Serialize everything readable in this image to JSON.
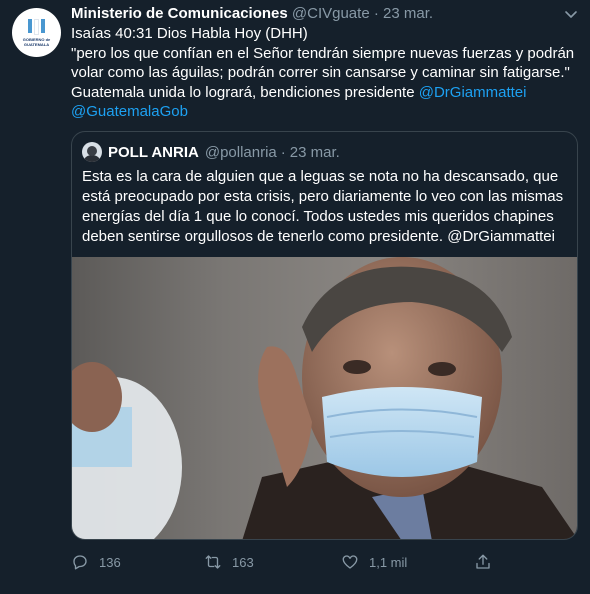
{
  "tweet": {
    "author_name": "Ministerio de Comunicaciones",
    "author_handle": "@CIVguate",
    "date": "23 mar.",
    "separator": "·",
    "avatar_logo_text": "GOBIERNO de GUATEMALA",
    "body": {
      "line1": "Isaías 40:31 Dios Habla Hoy (DHH)",
      "line2": "\"pero los que confían en el Señor tendrán siempre nuevas fuerzas y podrán",
      "line3": "volar como las águilas; podrán correr sin cansarse y caminar sin fatigarse.\"",
      "line4_text": "Guatemala unida lo logrará, bendiciones presidente ",
      "mention1": "@DrGiammattei",
      "mention2": "@GuatemalaGob"
    }
  },
  "quoted_tweet": {
    "author_name": "POLL ANRIA",
    "author_handle": "@pollanria",
    "separator": "·",
    "date": "23 mar.",
    "text": {
      "line1": "Esta es la cara de alguien que a leguas se nota no ha descansado, que",
      "line2": "está preocupado por esta crisis, pero diariamente lo veo con las mismas",
      "line3": "energías del día 1 que lo conocí. Todos ustedes mis queridos chapines",
      "line4": "deben sentirse orgullosos de tenerlo como presidente. @DrGiammattei"
    }
  },
  "actions": {
    "reply_count": "136",
    "retweet_count": "163",
    "like_count": "1,1 mil"
  },
  "colors": {
    "background": "#15202b",
    "link": "#1da1f2",
    "muted": "#8899a6",
    "border": "#38444d"
  },
  "icons": [
    "caret-down-icon",
    "reply-icon",
    "retweet-icon",
    "like-icon",
    "share-icon"
  ]
}
